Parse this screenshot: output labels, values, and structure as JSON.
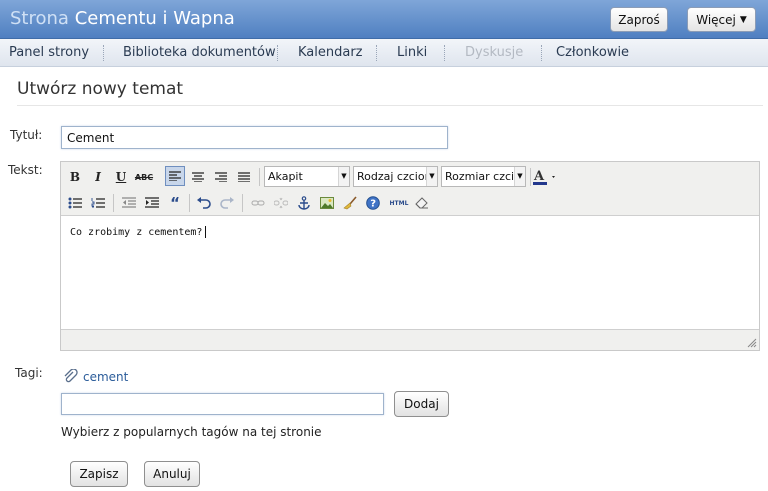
{
  "header": {
    "site_prefix": "Strona",
    "site_name": "Cementu i Wapna",
    "invite_label": "Zaproś",
    "more_label": "Więcej"
  },
  "nav": {
    "items": [
      {
        "label": "Panel strony"
      },
      {
        "label": "Biblioteka dokumentów"
      },
      {
        "label": "Kalendarz"
      },
      {
        "label": "Linki"
      },
      {
        "label": "Dyskusje"
      },
      {
        "label": "Członkowie"
      }
    ]
  },
  "page": {
    "title": "Utwórz nowy temat"
  },
  "form": {
    "title_label": "Tytuł:",
    "title_value": "Cement",
    "text_label": "Tekst:",
    "tags_label": "Tagi:",
    "save_label": "Zapisz",
    "cancel_label": "Anuluj"
  },
  "editor": {
    "format_select": "Akapit",
    "font_select": "Rodzaj czcionk",
    "size_select": "Rozmiar czcion",
    "html_label": "HTML",
    "content": "Co zrobimy z cementem?"
  },
  "tags": {
    "items": [
      "cement"
    ],
    "add_label": "Dodaj",
    "input_value": "",
    "help_text": "Wybierz z popularnych tagów na tej stronie"
  },
  "colors": {
    "header_top": "#7fa6d8",
    "header_bottom": "#4f7fc1",
    "link": "#2b5c9a"
  }
}
